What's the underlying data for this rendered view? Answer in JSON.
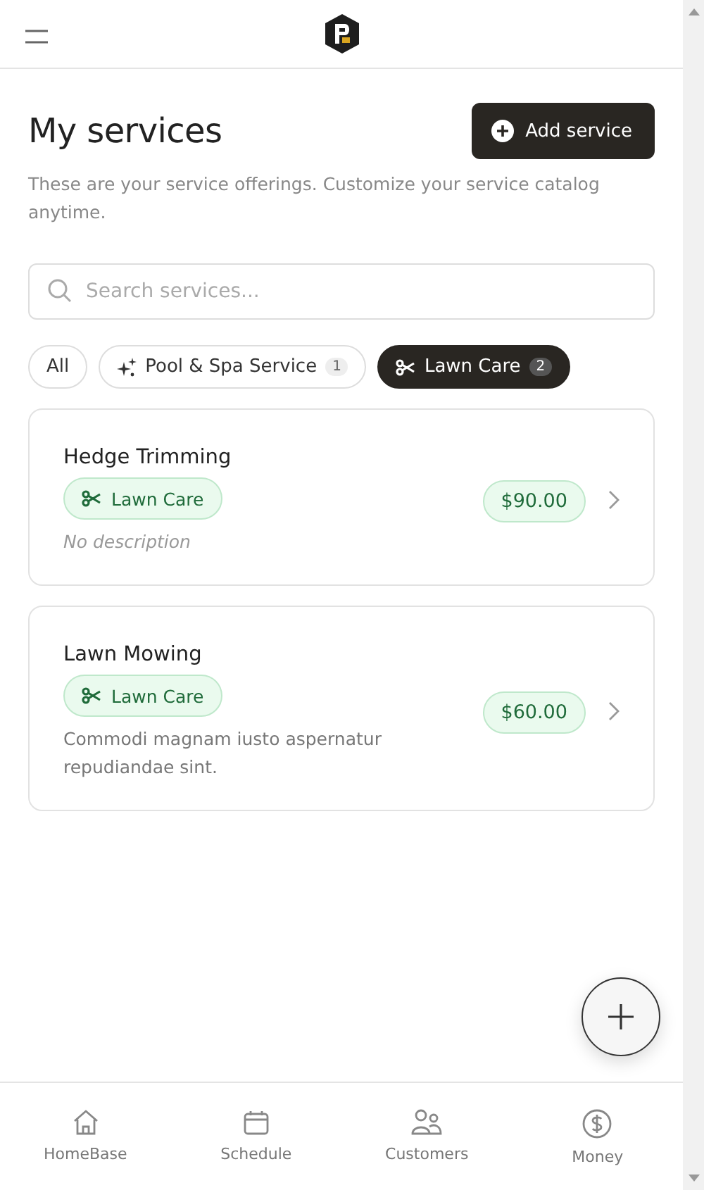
{
  "header": {
    "title": "My services",
    "subtitle": "These are your service offerings. Customize your service catalog anytime.",
    "add_button": "Add service"
  },
  "search": {
    "placeholder": "Search services..."
  },
  "filters": [
    {
      "label": "All",
      "kind": "all",
      "selected": false
    },
    {
      "label": "Pool & Spa Service",
      "kind": "pool",
      "count": "1",
      "selected": false
    },
    {
      "label": "Lawn Care",
      "kind": "lawn",
      "count": "2",
      "selected": true
    }
  ],
  "services": [
    {
      "name": "Hedge Trimming",
      "category": {
        "label": "Lawn Care",
        "kind": "lawn"
      },
      "description": "No description",
      "has_description": false,
      "price": "$90.00"
    },
    {
      "name": "Lawn Mowing",
      "category": {
        "label": "Lawn Care",
        "kind": "lawn"
      },
      "description": "Commodi magnam iusto aspernatur repudiandae sint.",
      "has_description": true,
      "price": "$60.00"
    }
  ],
  "nav": [
    {
      "label": "HomeBase",
      "kind": "home"
    },
    {
      "label": "Schedule",
      "kind": "calendar"
    },
    {
      "label": "Customers",
      "kind": "people"
    },
    {
      "label": "Money",
      "kind": "dollar"
    }
  ]
}
